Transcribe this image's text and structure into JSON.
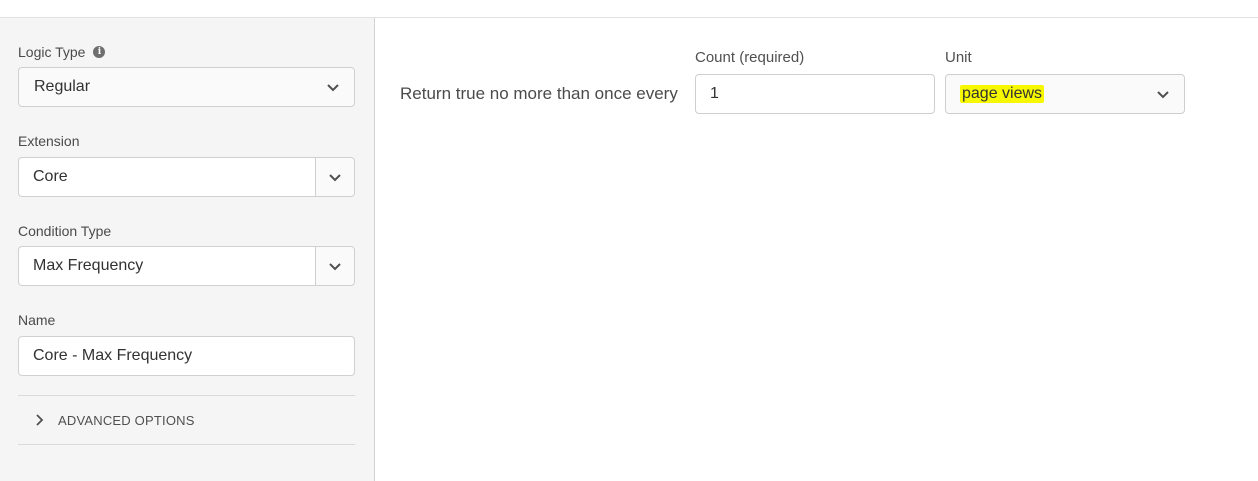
{
  "sidebar": {
    "logic_type": {
      "label": "Logic Type",
      "value": "Regular",
      "info_icon": "info-icon"
    },
    "extension": {
      "label": "Extension",
      "value": "Core"
    },
    "condition_type": {
      "label": "Condition Type",
      "value": "Max Frequency"
    },
    "name": {
      "label": "Name",
      "value": "Core - Max Frequency"
    },
    "advanced_options": {
      "label": "ADVANCED OPTIONS",
      "icon": "chevron-right-icon"
    }
  },
  "main": {
    "return_text": "Return true no more than once every",
    "count": {
      "label": "Count (required)",
      "value": "1"
    },
    "unit": {
      "label": "Unit",
      "value": "page views",
      "highlight_color": "#f7f700"
    }
  }
}
